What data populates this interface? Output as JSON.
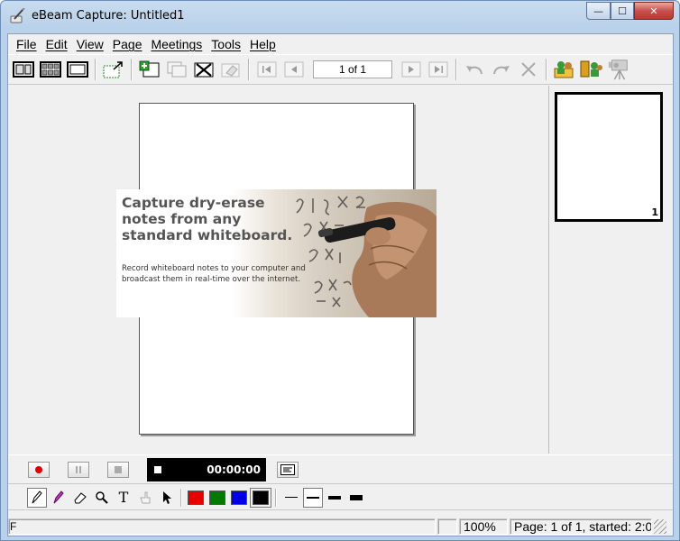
{
  "window": {
    "title": "eBeam Capture: Untitled1",
    "minimize_label": "—",
    "maximize_label": "☐",
    "close_label": "✕"
  },
  "menu": [
    "File",
    "Edit",
    "View",
    "Page",
    "Meetings",
    "Tools",
    "Help"
  ],
  "toolbar": {
    "page_indicator": "1 of 1"
  },
  "banner": {
    "headline": "Capture dry-erase notes from any standard whiteboard.",
    "body": "Record whiteboard notes to your computer and broadcast them in real-time over the internet."
  },
  "thumbnail": {
    "page_number": "1"
  },
  "recorder": {
    "time": "00:00:00"
  },
  "drawing": {
    "text_tool_glyph": "T",
    "colors": [
      "#e60000",
      "#007a00",
      "#0000e6",
      "#000000"
    ],
    "selected_color": "#000000"
  },
  "status": {
    "left": "F",
    "zoom": "100%",
    "page_info": "Page: 1 of 1, started: 2:0"
  }
}
